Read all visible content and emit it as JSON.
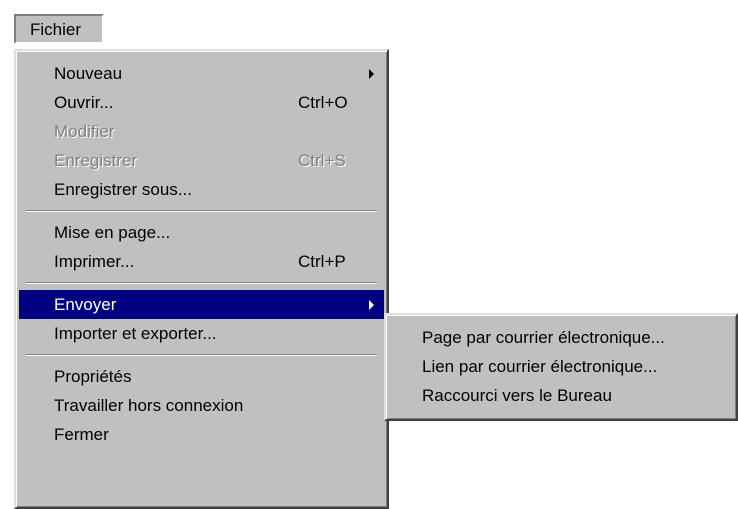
{
  "menubar": {
    "file_label": "Fichier"
  },
  "main_menu": {
    "items": [
      {
        "label": "Nouveau"
      },
      {
        "label": "Ouvrir...",
        "shortcut": "Ctrl+O"
      },
      {
        "label": "Modifier"
      },
      {
        "label": "Enregistrer",
        "shortcut": "Ctrl+S"
      },
      {
        "label": "Enregistrer sous..."
      },
      {
        "label": "Mise en page..."
      },
      {
        "label": "Imprimer...",
        "shortcut": "Ctrl+P"
      },
      {
        "label": "Envoyer"
      },
      {
        "label": "Importer et exporter..."
      },
      {
        "label": "Propriétés"
      },
      {
        "label": "Travailler hors connexion"
      },
      {
        "label": "Fermer"
      }
    ]
  },
  "send_submenu": {
    "items": [
      {
        "label": "Page par courrier électronique..."
      },
      {
        "label": "Lien par courrier électronique..."
      },
      {
        "label": "Raccourci vers le Bureau"
      }
    ]
  },
  "colors": {
    "menu_bg": "#c0c0c0",
    "highlight_bg": "#000080",
    "highlight_text": "#ffffff",
    "disabled_text": "#808080"
  },
  "icons": [
    "submenu-arrow-icon"
  ]
}
